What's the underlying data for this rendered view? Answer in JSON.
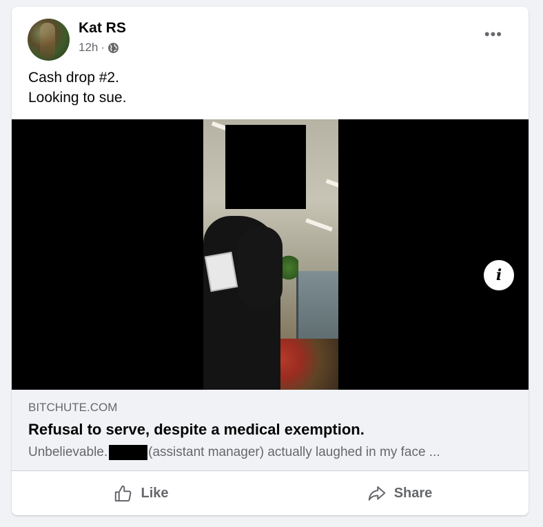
{
  "post": {
    "author": "Kat RS",
    "timestamp": "12h",
    "separator": "·",
    "audience_icon": "globe-icon",
    "more_icon": "•••",
    "text_lines": [
      "Cash drop #2.",
      "Looking to sue."
    ]
  },
  "media": {
    "info_icon": "i"
  },
  "link": {
    "domain": "BITCHUTE.COM",
    "title": "Refusal to serve, despite a medical exemption.",
    "desc_before": "Unbelievable.",
    "desc_after": "(assistant manager) actually laughed in my face ..."
  },
  "actions": {
    "like_label": "Like",
    "share_label": "Share"
  },
  "colors": {
    "background": "#f0f2f5",
    "card": "#ffffff",
    "secondary_text": "#65676b",
    "primary_text": "#050505"
  }
}
